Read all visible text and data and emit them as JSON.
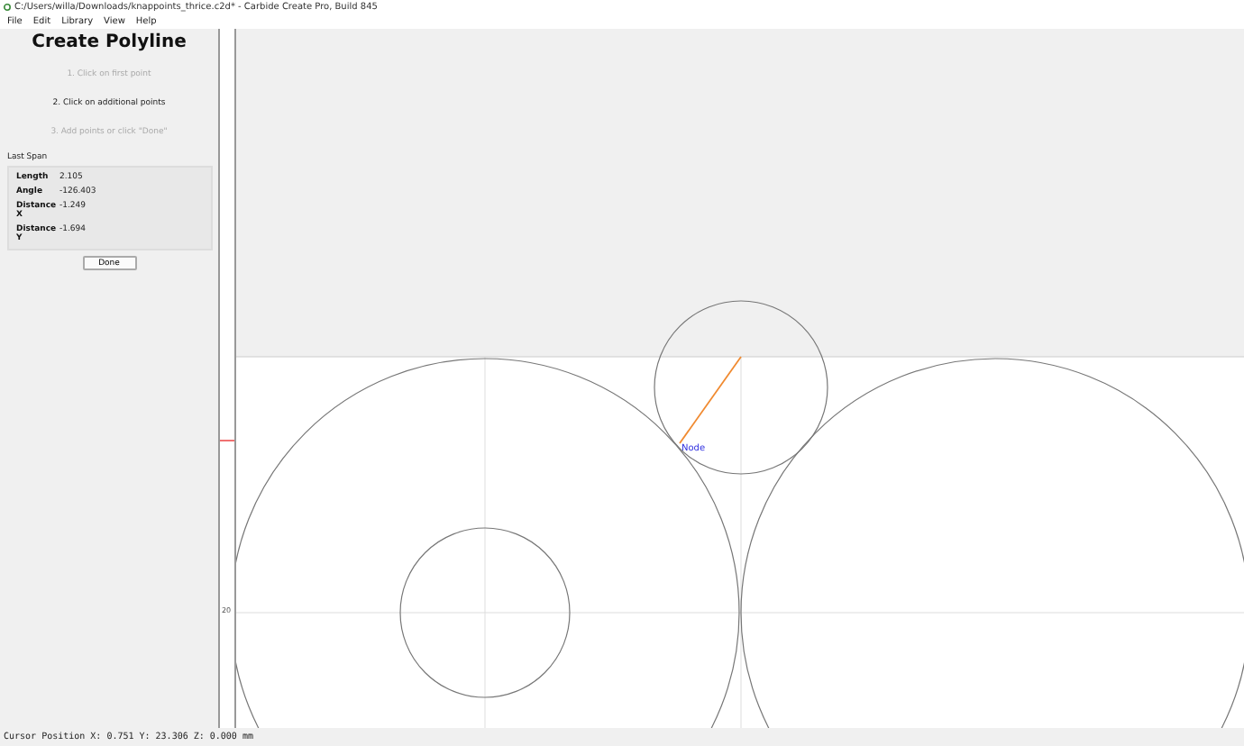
{
  "window": {
    "title": "C:/Users/willa/Downloads/knappoints_thrice.c2d* - Carbide Create Pro, Build 845"
  },
  "menu": [
    "File",
    "Edit",
    "Library",
    "View",
    "Help"
  ],
  "panel": {
    "title": "Create Polyline",
    "steps": [
      {
        "label": "1. Click on first point",
        "selected": false
      },
      {
        "label": "2. Click on additional points",
        "selected": true
      },
      {
        "label": "3. Add points or click \"Done\"",
        "selected": false
      }
    ],
    "section": "Last Span",
    "stats": [
      {
        "name": "Length",
        "value": "2.105"
      },
      {
        "name": "Angle",
        "value": "-126.403"
      },
      {
        "name": "Distance X",
        "value": "-1.249"
      },
      {
        "name": "Distance Y",
        "value": "-1.694"
      }
    ],
    "button": "Done"
  },
  "canvas": {
    "node_label": "Node",
    "ruler_label": "20"
  },
  "status_bar": "Cursor Position X: 0.751 Y: 23.306 Z: 0.000 mm"
}
